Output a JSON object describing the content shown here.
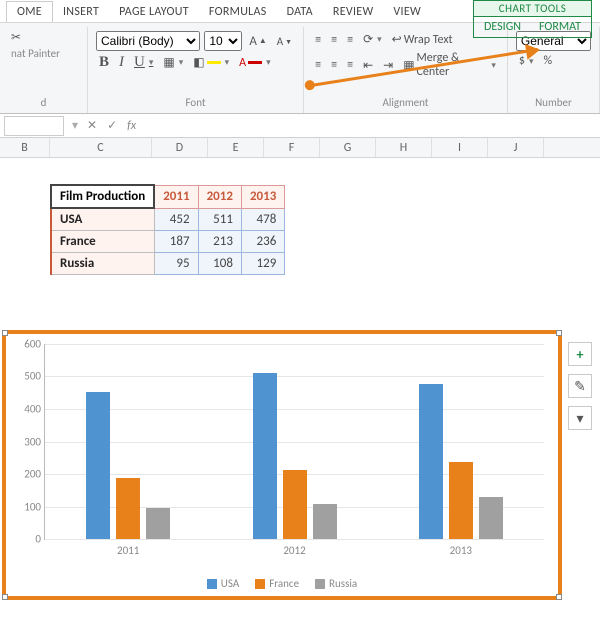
{
  "tabs": {
    "home": "OME",
    "insert": "INSERT",
    "pagelayout": "PAGE LAYOUT",
    "formulas": "FORMULAS",
    "data": "DATA",
    "review": "REVIEW",
    "view": "VIEW"
  },
  "contextual": {
    "title": "CHART TOOLS",
    "design": "DESIGN",
    "format": "FORMAT"
  },
  "ribbon": {
    "clipboard": {
      "format_painter": "nat Painter",
      "group": "d"
    },
    "font": {
      "name": "Calibri (Body)",
      "size": "10",
      "group": "Font",
      "increase": "A˄",
      "decrease": "A˅",
      "bold": "B",
      "italic": "I",
      "underline": "U"
    },
    "alignment": {
      "wrap": "Wrap Text",
      "merge": "Merge & Center",
      "group": "Alignment"
    },
    "number": {
      "category": "General",
      "group": "Number",
      "currency": "$",
      "percent": "%"
    }
  },
  "fbar": {
    "namebox": "",
    "fx": "fx",
    "cancel": "✕",
    "enter": "✓"
  },
  "columns": {
    "B": "B",
    "C": "C",
    "D": "D",
    "E": "E",
    "F": "F",
    "G": "G",
    "H": "H",
    "I": "I",
    "J": "J"
  },
  "table": {
    "corner": "Film Production",
    "years": [
      "2011",
      "2012",
      "2013"
    ],
    "rows": [
      {
        "label": "USA",
        "vals": [
          "452",
          "511",
          "478"
        ]
      },
      {
        "label": "France",
        "vals": [
          "187",
          "213",
          "236"
        ]
      },
      {
        "label": "Russia",
        "vals": [
          "95",
          "108",
          "129"
        ]
      }
    ]
  },
  "chart_data": {
    "type": "bar",
    "categories": [
      "2011",
      "2012",
      "2013"
    ],
    "series": [
      {
        "name": "USA",
        "values": [
          452,
          511,
          478
        ],
        "color": "#4f93d1"
      },
      {
        "name": "France",
        "values": [
          187,
          213,
          236
        ],
        "color": "#e8811a"
      },
      {
        "name": "Russia",
        "values": [
          95,
          108,
          129
        ],
        "color": "#a0a0a0"
      }
    ],
    "yticks": [
      0,
      100,
      200,
      300,
      400,
      500,
      600
    ],
    "ylim": [
      0,
      600
    ],
    "legend": [
      "USA",
      "France",
      "Russia"
    ]
  },
  "chart_buttons": {
    "add": "+",
    "style": "✎",
    "filter": "▼"
  }
}
